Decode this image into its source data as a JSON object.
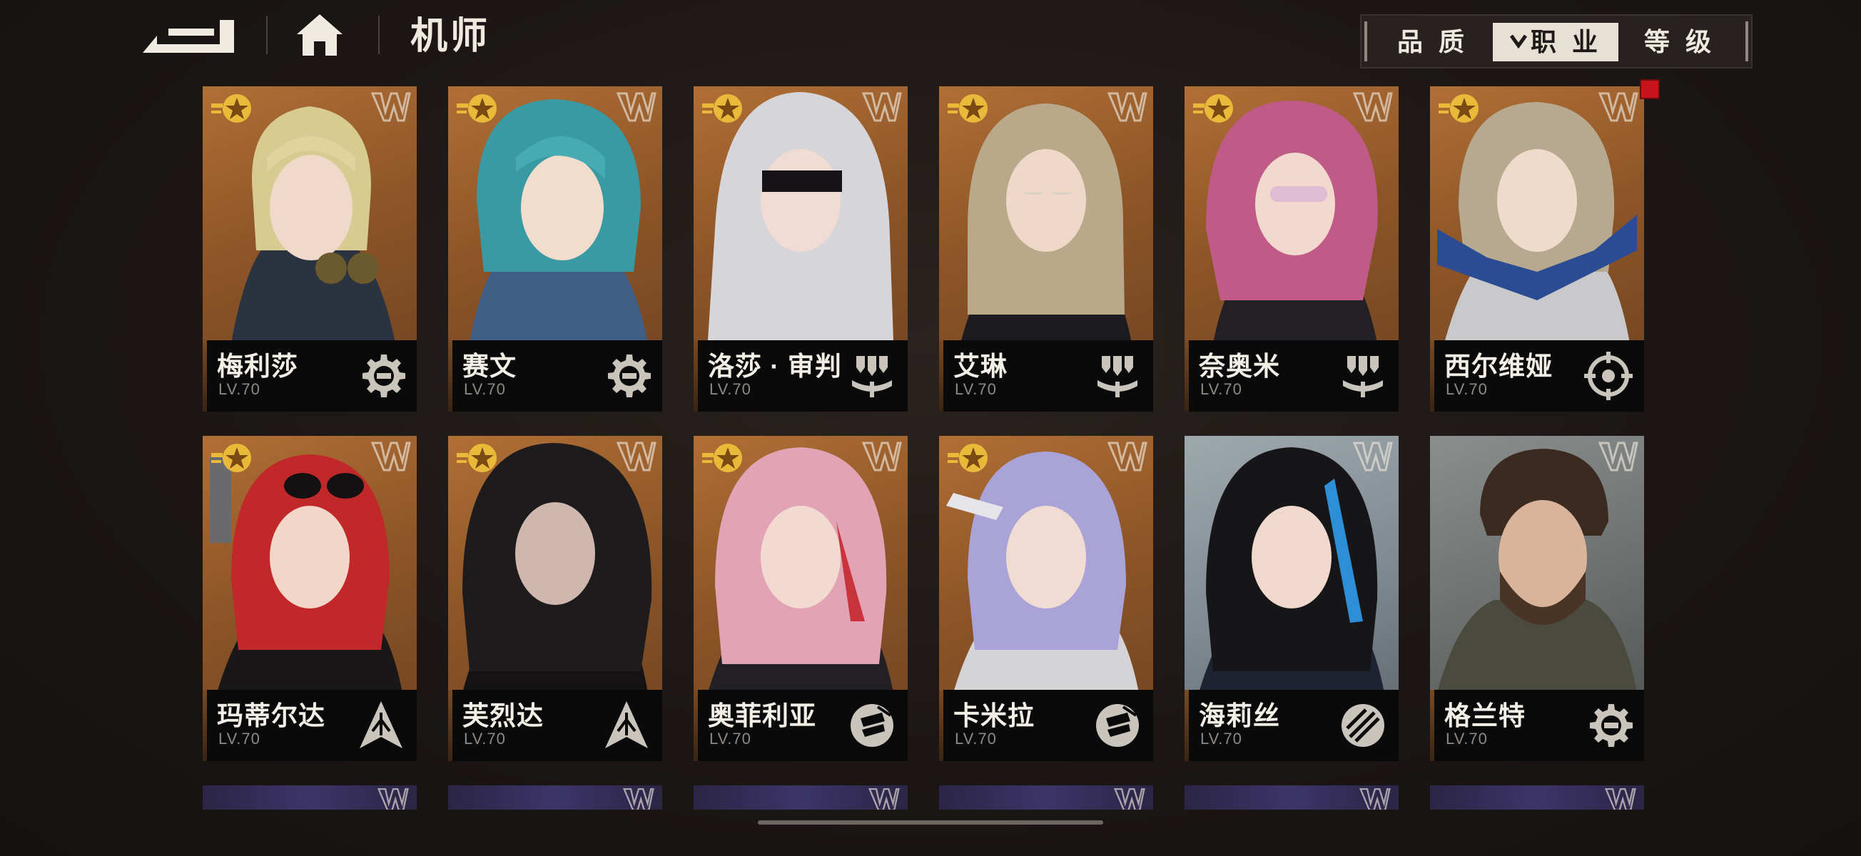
{
  "header": {
    "title": "机师",
    "back_icon": "back-arrow-icon",
    "home_icon": "home-icon"
  },
  "filters": {
    "tabs": [
      {
        "label": "品 质",
        "active": false
      },
      {
        "label": "职 业",
        "active": true,
        "icon": "chevron-down-icon"
      },
      {
        "label": "等 级",
        "active": false
      }
    ]
  },
  "pilots": [
    {
      "name": "梅利莎",
      "level": "LV.70",
      "class_icon": "wrench-gear-icon",
      "rank_icon": "star-badge-icon",
      "tier_icon": "tier-w-icon"
    },
    {
      "name": "赛文",
      "level": "LV.70",
      "class_icon": "wrench-gear-icon",
      "rank_icon": "star-badge-icon",
      "tier_icon": "tier-w-icon"
    },
    {
      "name": "洛莎 · 审判",
      "level": "LV.70",
      "class_icon": "bombs-icon",
      "rank_icon": "star-badge-icon",
      "tier_icon": "tier-w-icon"
    },
    {
      "name": "艾琳",
      "level": "LV.70",
      "class_icon": "bombs-icon",
      "rank_icon": "star-badge-icon",
      "tier_icon": "tier-w-icon"
    },
    {
      "name": "奈奥米",
      "level": "LV.70",
      "class_icon": "bombs-icon",
      "rank_icon": "star-badge-icon",
      "tier_icon": "tier-w-icon"
    },
    {
      "name": "西尔维娅",
      "level": "LV.70",
      "class_icon": "crosshair-icon",
      "rank_icon": "star-badge-icon",
      "tier_icon": "tier-w-icon"
    },
    {
      "name": "玛蒂尔达",
      "level": "LV.70",
      "class_icon": "spike-icon",
      "rank_icon": "star-badge-icon",
      "tier_icon": "tier-w-icon"
    },
    {
      "name": "芙烈达",
      "level": "LV.70",
      "class_icon": "spike-icon",
      "rank_icon": "star-badge-icon",
      "tier_icon": "tier-w-icon"
    },
    {
      "name": "奥菲利亚",
      "level": "LV.70",
      "class_icon": "fist-icon",
      "rank_icon": "star-badge-icon",
      "tier_icon": "tier-w-icon"
    },
    {
      "name": "卡米拉",
      "level": "LV.70",
      "class_icon": "fist-icon",
      "rank_icon": "star-badge-icon",
      "tier_icon": "tier-w-icon"
    },
    {
      "name": "海莉丝",
      "level": "LV.70",
      "class_icon": "slash-circle-icon",
      "rank_icon": "star-badge-icon",
      "tier_icon": "tier-w-icon"
    },
    {
      "name": "格兰特",
      "level": "LV.70",
      "class_icon": "wrench-gear-icon",
      "rank_icon": "",
      "tier_icon": "tier-w-icon"
    }
  ],
  "colors": {
    "card_bg": "#9a5d2c",
    "card_bg_purple": "#3a3366",
    "accent_gold": "#e9b93a",
    "new_indicator": "#c8131b",
    "active_tab_bg": "#e6e0d5"
  }
}
